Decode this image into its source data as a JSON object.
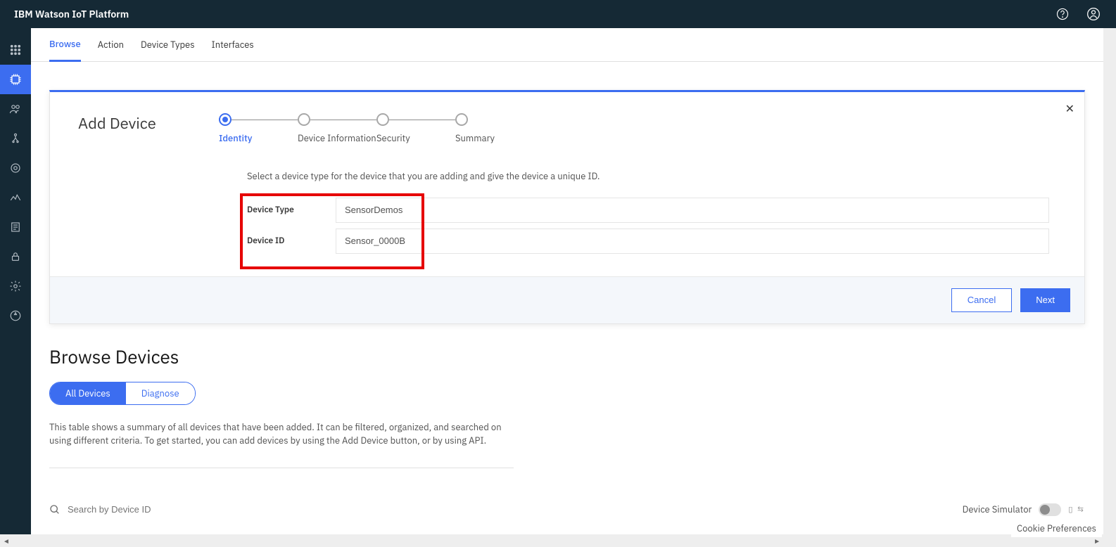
{
  "header": {
    "title": "IBM Watson IoT Platform"
  },
  "sidebar_icons": [
    "apps",
    "chip",
    "members",
    "devices",
    "usage",
    "analytics",
    "logs",
    "security",
    "settings",
    "extensions"
  ],
  "tabs": {
    "browse": "Browse",
    "action": "Action",
    "device_types": "Device Types",
    "interfaces": "Interfaces"
  },
  "modal": {
    "title": "Add Device",
    "steps": {
      "identity": "Identity",
      "device_info": "Device Information",
      "security": "Security",
      "summary": "Summary"
    },
    "instructions": "Select a device type for the device that you are adding and give the device a unique ID.",
    "fields": {
      "type_label": "Device Type",
      "type_value": "SensorDemos",
      "id_label": "Device ID",
      "id_value": "Sensor_0000B"
    },
    "cancel": "Cancel",
    "next": "Next"
  },
  "browse": {
    "title": "Browse Devices",
    "pill_all": "All Devices",
    "pill_diag": "Diagnose",
    "description": "This table shows a summary of all devices that have been added. It can be filtered, organized, and searched on using different criteria. To get started, you can add devices by using the Add Device button, or by using API.",
    "search_placeholder": "Search by Device ID",
    "simulator_label": "Device Simulator"
  },
  "cookie_pref": "Cookie Preferences"
}
